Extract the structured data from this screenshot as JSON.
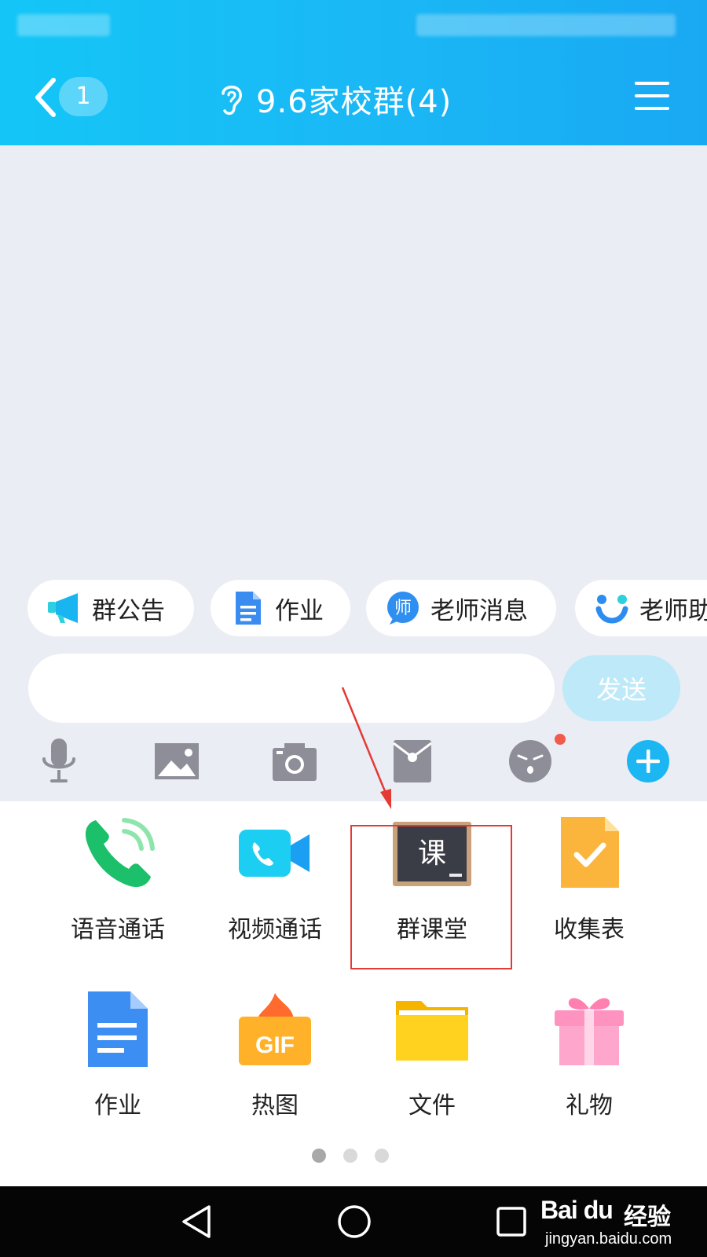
{
  "header": {
    "back_badge": "1",
    "title": "9.6家校群(4)"
  },
  "chips": [
    {
      "label": "群公告",
      "icon": "megaphone-icon"
    },
    {
      "label": "作业",
      "icon": "document-icon"
    },
    {
      "label": "老师消息",
      "icon": "teacher-message-icon"
    },
    {
      "label": "老师助",
      "icon": "teacher-assistant-icon"
    }
  ],
  "input": {
    "value": "",
    "placeholder": "",
    "send_label": "发送"
  },
  "toolbar": [
    "microphone-icon",
    "image-icon",
    "camera-icon",
    "red-packet-icon",
    "emoji-icon",
    "plus-icon"
  ],
  "panel": {
    "items": [
      {
        "label": "语音通话",
        "icon": "voice-call-icon"
      },
      {
        "label": "视频通话",
        "icon": "video-call-icon"
      },
      {
        "label": "群课堂",
        "icon": "group-classroom-icon",
        "icon_text": "课"
      },
      {
        "label": "收集表",
        "icon": "collection-form-icon"
      },
      {
        "label": "作业",
        "icon": "homework-icon"
      },
      {
        "label": "热图",
        "icon": "hot-gif-icon",
        "icon_text": "GIF"
      },
      {
        "label": "文件",
        "icon": "folder-icon"
      },
      {
        "label": "礼物",
        "icon": "gift-icon"
      }
    ],
    "page_count": 3,
    "active_page": 1
  },
  "navbar": [
    "back-triangle-icon",
    "home-circle-icon",
    "recents-square-icon"
  ],
  "watermark": {
    "logo": "Bai du",
    "brand": "经验",
    "url": "jingyan.baidu.com"
  },
  "colors": {
    "header": "#14c6f7",
    "accent": "#1ab7f5",
    "highlight": "#e53935"
  }
}
